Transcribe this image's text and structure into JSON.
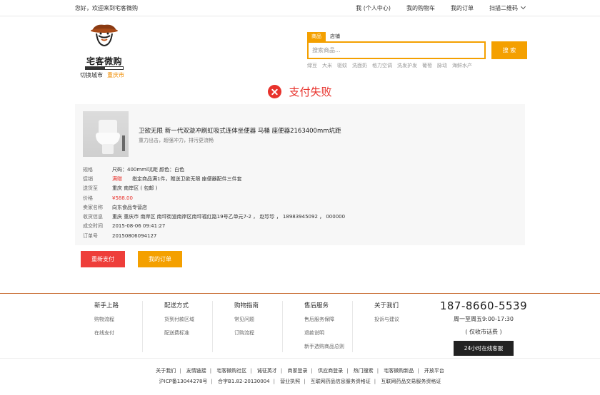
{
  "topbar": {
    "welcome": "您好，欢迎来到宅客微购",
    "links": [
      "我 (个人中心)",
      "我的购物车",
      "我的订单",
      "扫描二维码"
    ]
  },
  "logo": {
    "brand": "宅客微购"
  },
  "city": {
    "label": "切换城市",
    "name": "重庆市"
  },
  "search": {
    "tabs": [
      "商品",
      "店铺"
    ],
    "placeholder": "搜索商品...",
    "button": "搜 索",
    "hot": [
      "绿豆",
      "大米",
      "驱蚊",
      "洗面奶",
      "格力空调",
      "洗发护发",
      "葡萄",
      "脉动",
      "海鲜水产"
    ]
  },
  "status": {
    "text": "支付失败"
  },
  "product": {
    "name": "卫欲无限 新一代双漩冲刷虹吸式连体坐便器 马桶 座便器2163400mm坑距",
    "desc": "重力出击，超强冲力，排污更流畅"
  },
  "order_rows": [
    {
      "key": "规格",
      "value": "尺码：400mml坑距 颜色：白色"
    },
    {
      "key": "促销",
      "tag": "满赠",
      "value": "指定商品满1件，赠送卫欲无限 座便器配件三件套"
    },
    {
      "key": "送货至",
      "value": "重庆 南岸区 ( 包邮 )"
    },
    {
      "key": "价格",
      "value": "¥588.00",
      "price": true
    },
    {
      "key": "卖家名称",
      "value": "向东食品专营店"
    },
    {
      "key": "收货信息",
      "value": "重庆 重庆市 南岸区 南坪街道南岸区南坪福红路19号乙单元7-2 ， 赵珍珍 ， 18983945092 ， 000000"
    },
    {
      "key": "成交时间",
      "value": "2015-08-06 09:41:27"
    },
    {
      "key": "订单号",
      "value": "20150806094127"
    }
  ],
  "actions": {
    "retry": "重新支付",
    "orders": "我的订单"
  },
  "footer": {
    "columns": [
      {
        "title": "新手上路",
        "items": [
          "购物流程",
          "在线支付"
        ]
      },
      {
        "title": "配送方式",
        "items": [
          "货到付款区域",
          "配送费标准"
        ]
      },
      {
        "title": "购物指南",
        "items": [
          "常见问题",
          "订购流程"
        ]
      },
      {
        "title": "售后服务",
        "items": [
          "售后服务保障",
          "退款说明",
          "新手选购商品总则"
        ]
      },
      {
        "title": "关于我们",
        "items": [
          "投诉与建议"
        ]
      }
    ],
    "phone": "187-8660-5539",
    "hours": "周一至周五9:00-17:30",
    "note": "( 仅收市话费 )",
    "service": "24小时在线客服"
  },
  "bottom": {
    "links": [
      "关于我们",
      "友情链接",
      "宅客微购社区",
      "诚征英才",
      "商家登录",
      "供应商登录",
      "热门搜索",
      "宅客微购新品",
      "开放平台"
    ],
    "icp": [
      "沪ICP备13044278号",
      "合字B1.82-20130004",
      "营业执照",
      "互联网药品信息服务资格证",
      "互联网药品交易服务资格证"
    ]
  },
  "colors": {
    "accent": "#f4a000",
    "error": "#e8322c"
  }
}
